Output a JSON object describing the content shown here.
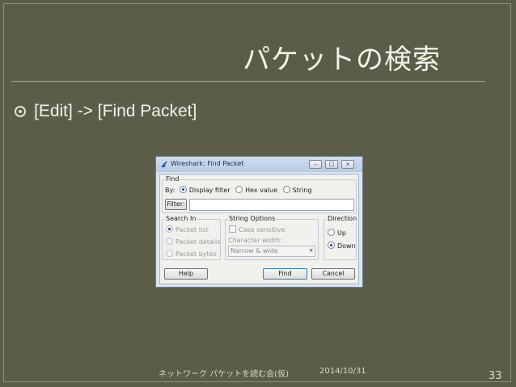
{
  "slide": {
    "title": "パケットの検索",
    "bullet": "[Edit] -> [Find Packet]",
    "footer": "ネットワーク パケットを読む会(仮)",
    "date": "2014/10/31",
    "page_number": "33"
  },
  "dialog": {
    "title": "Wireshark: Find Packet",
    "window_buttons": [
      "–",
      "□",
      "×"
    ],
    "find_group": {
      "label": "Find",
      "by_label": "By:",
      "options": [
        "Display filter",
        "Hex value",
        "String"
      ],
      "selected": "Display filter",
      "filter_button": "Filter:",
      "filter_value": ""
    },
    "search_in": {
      "label": "Search In",
      "options": [
        "Packet list",
        "Packet details",
        "Packet bytes"
      ],
      "selected": "Packet list"
    },
    "string_options": {
      "label": "String Options",
      "case_sensitive": "Case sensitive",
      "char_width_label": "Character width:",
      "char_width_value": "Narrow & wide"
    },
    "direction": {
      "label": "Direction",
      "options": [
        "Up",
        "Down"
      ],
      "selected": "Down"
    },
    "buttons": {
      "help": "Help",
      "find": "Find",
      "cancel": "Cancel"
    }
  }
}
